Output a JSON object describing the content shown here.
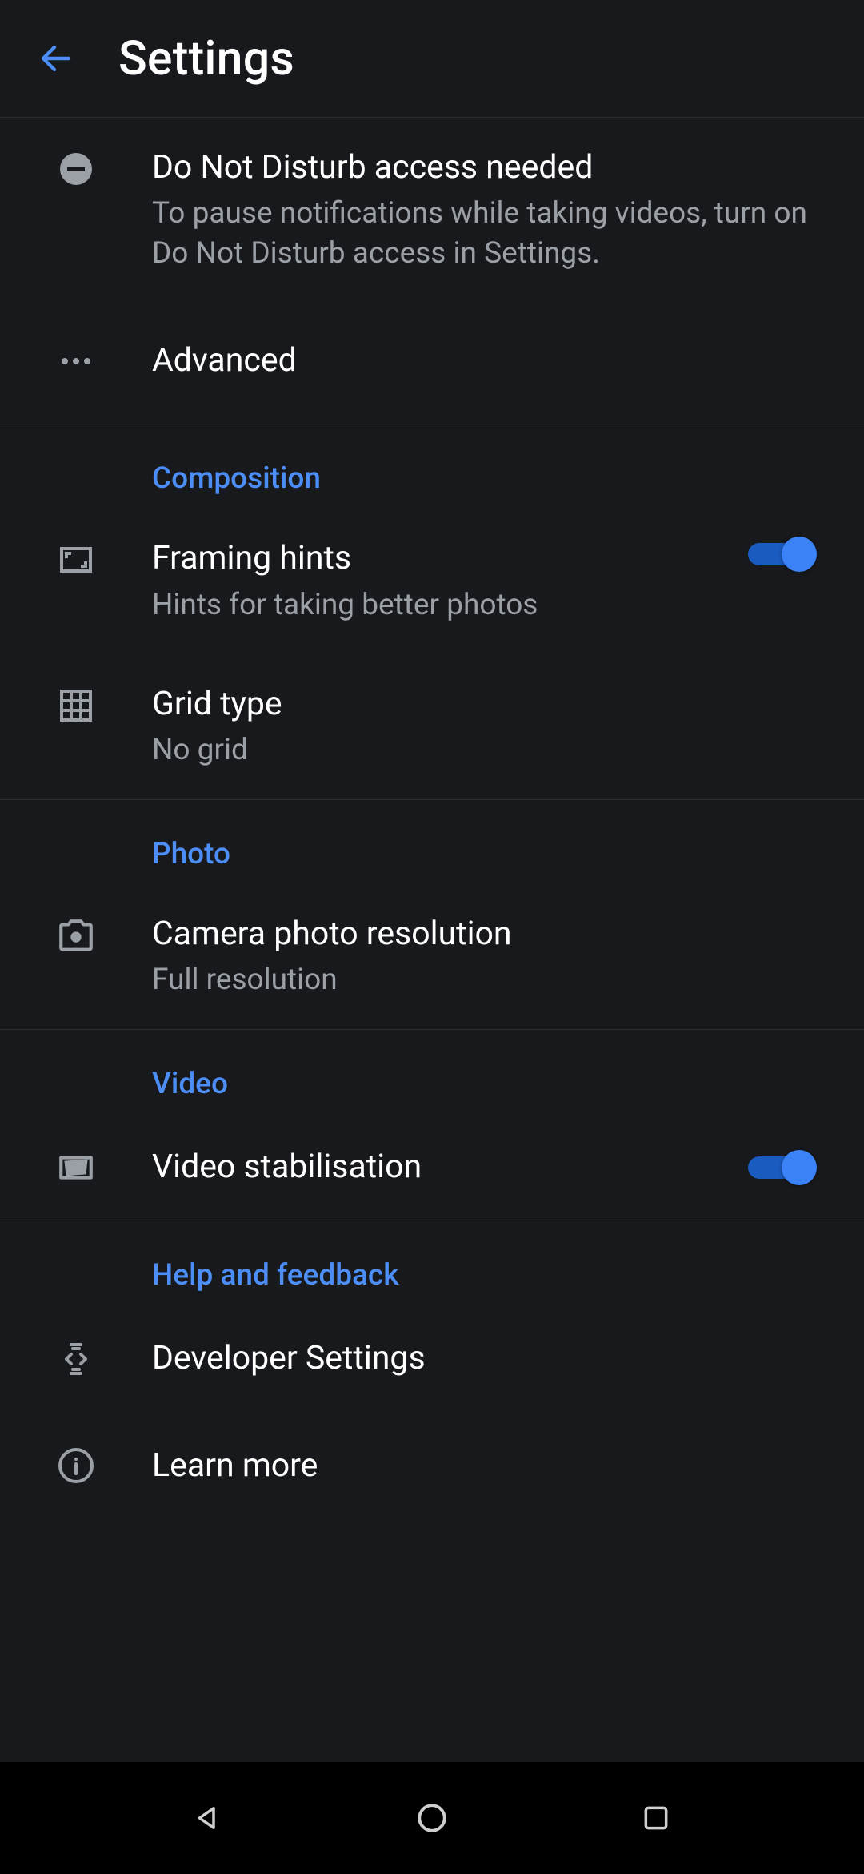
{
  "header": {
    "title": "Settings"
  },
  "colors": {
    "accent": "#4c8df6",
    "bg": "#17191c"
  },
  "items": {
    "dnd": {
      "title": "Do Not Disturb access needed",
      "sub": "To pause notifications while taking videos, turn on Do Not Disturb access in Settings."
    },
    "advanced": {
      "title": "Advanced"
    }
  },
  "sections": {
    "composition": {
      "label": "Composition",
      "framing_hints": {
        "title": "Framing hints",
        "sub": "Hints for taking better photos",
        "on": true
      },
      "grid_type": {
        "title": "Grid type",
        "sub": "No grid"
      }
    },
    "photo": {
      "label": "Photo",
      "resolution": {
        "title": "Camera photo resolution",
        "sub": "Full resolution"
      }
    },
    "video": {
      "label": "Video",
      "stabilisation": {
        "title": "Video stabilisation",
        "on": true
      }
    },
    "help": {
      "label": "Help and feedback",
      "developer": {
        "title": "Developer Settings"
      },
      "learn": {
        "title": "Learn more"
      }
    }
  }
}
